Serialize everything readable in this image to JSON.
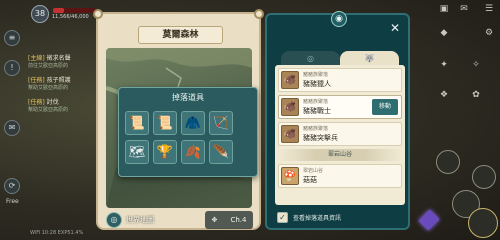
{
  "hud": {
    "level": "38",
    "hp_text": "11,566/46,000",
    "hp_fraction": 0.25,
    "free_label": "Free",
    "status": {
      "wifi": "WiFi",
      "time": "10:28",
      "exp": "EXP51.4%"
    }
  },
  "quests": [
    {
      "tag": "[主線]",
      "title": "徵求名聲",
      "sub": "前往艾歐亞高原的"
    },
    {
      "tag": "[任務]",
      "title": "孩子照護",
      "sub": "幫助艾歐亞高原的"
    },
    {
      "tag": "[任務]",
      "title": "討伐",
      "sub": "幫助艾歐亞高原的"
    }
  ],
  "map": {
    "title": "莫爾森林",
    "world_map_label": "世界地圖",
    "channel_label": "Ch.4"
  },
  "drop_popup": {
    "title": "掉落道具",
    "items": [
      {
        "icon": "scroll-icon"
      },
      {
        "icon": "scroll-icon"
      },
      {
        "icon": "armor-chest-icon"
      },
      {
        "icon": "crossbow-icon"
      },
      {
        "icon": "map-scroll-icon"
      },
      {
        "icon": "golden-statue-icon"
      },
      {
        "icon": "leaf-icon"
      },
      {
        "icon": "feather-icon"
      }
    ]
  },
  "monster_panel": {
    "close_label": "✕",
    "rows": [
      {
        "loc": "豬豬族聚落",
        "name": "豬豬獵人",
        "selected": false
      },
      {
        "loc": "豬豬族聚落",
        "name": "豬豬戰士",
        "selected": true,
        "action": "移動"
      },
      {
        "loc": "豬豬族聚落",
        "name": "豬豬突擊兵",
        "selected": false
      }
    ],
    "section_title": "翠岩山谷",
    "section_rows": [
      {
        "loc": "翠岩山谷",
        "name": "菇菇"
      }
    ],
    "footer_label": "查看掉落道具資訊",
    "footer_checked": "✓"
  }
}
